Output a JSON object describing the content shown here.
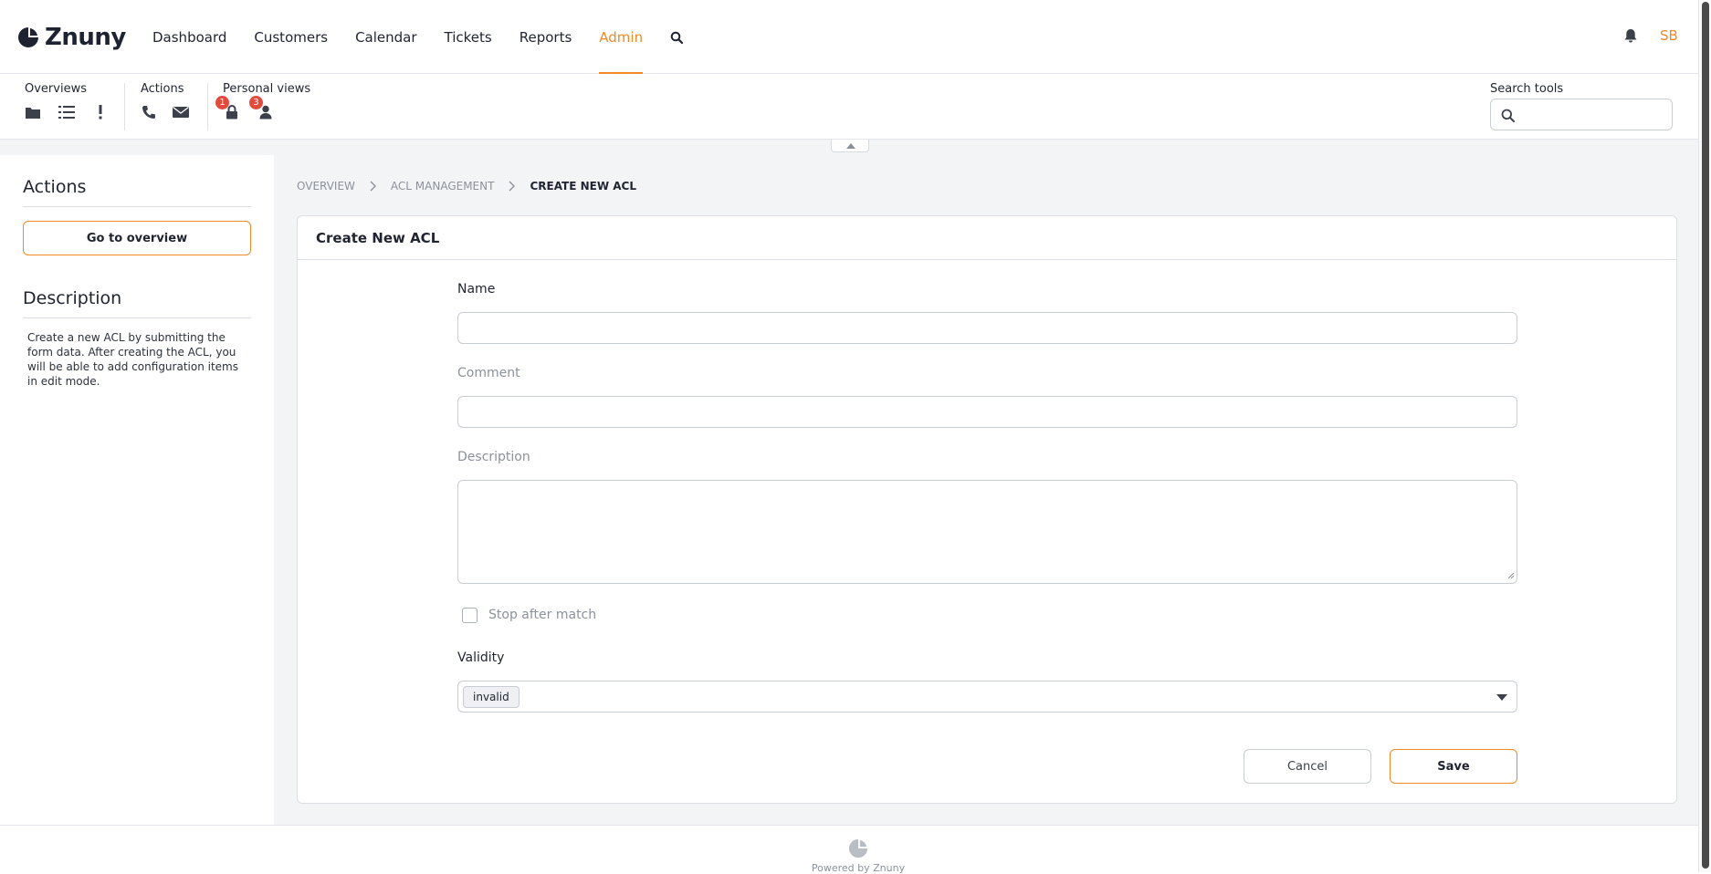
{
  "app": {
    "logo_text": "Znuny",
    "user_initials": "SB"
  },
  "nav": {
    "items": [
      {
        "label": "Dashboard",
        "active": false
      },
      {
        "label": "Customers",
        "active": false
      },
      {
        "label": "Calendar",
        "active": false
      },
      {
        "label": "Tickets",
        "active": false
      },
      {
        "label": "Reports",
        "active": false
      },
      {
        "label": "Admin",
        "active": true
      }
    ]
  },
  "toolbar": {
    "overviews_label": "Overviews",
    "actions_label": "Actions",
    "personal_views_label": "Personal views",
    "locked_count": "1",
    "watched_count": "3",
    "search_tools_label": "Search tools",
    "search_placeholder": ""
  },
  "sidebar": {
    "actions_heading": "Actions",
    "goto_overview_label": "Go to overview",
    "description_heading": "Description",
    "description_text": "Create a new ACL by submitting the form data. After creating the ACL, you will be able to add configuration items in edit mode."
  },
  "breadcrumb": {
    "items": [
      "Overview",
      "ACL Management",
      "Create New ACL"
    ]
  },
  "form": {
    "title": "Create New ACL",
    "name_label": "Name",
    "name_value": "",
    "comment_label": "Comment",
    "comment_value": "",
    "description_label": "Description",
    "description_value": "",
    "stop_after_match_label": "Stop after match",
    "stop_after_match_checked": false,
    "validity_label": "Validity",
    "validity_value": "invalid",
    "cancel_label": "Cancel",
    "save_label": "Save"
  },
  "footer": {
    "text": "Powered by Znuny"
  },
  "colors": {
    "accent": "#f08a24",
    "badge": "#e4493c",
    "background": "#f3f4f6",
    "text": "#1f2430"
  }
}
